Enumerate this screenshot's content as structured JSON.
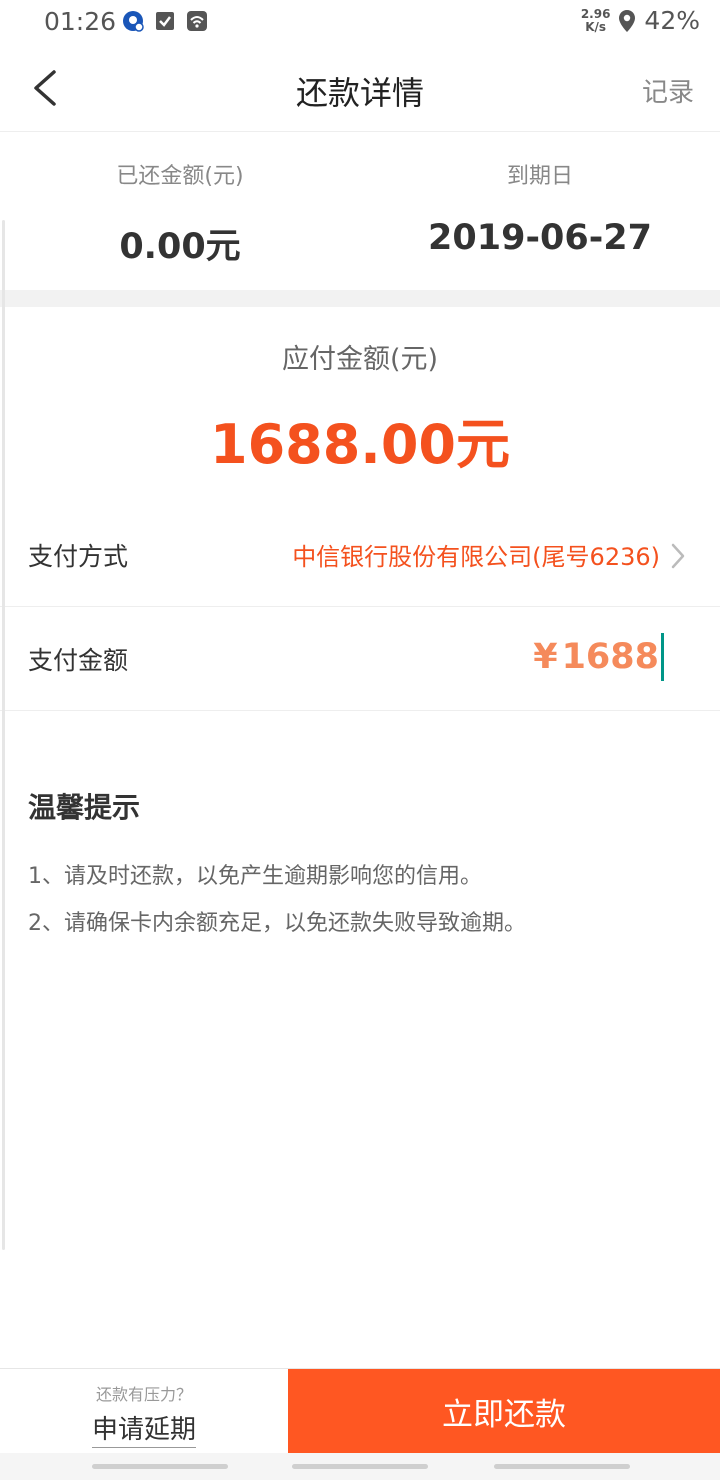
{
  "status_bar": {
    "time": "01:26",
    "net_speed_value": "2.96",
    "net_speed_unit": "K/s",
    "battery": "42%",
    "icons": [
      "notification-badge-icon",
      "checkbox-icon",
      "wifi-icon",
      "location-icon"
    ]
  },
  "nav": {
    "title": "还款详情",
    "record_label": "记录",
    "back_icon": "chevron-left-icon"
  },
  "summary": {
    "paid_label": "已还金额(元)",
    "paid_value": "0.00元",
    "due_date_label": "到期日",
    "due_date_value": "2019-06-27"
  },
  "due": {
    "label": "应付金额(元)",
    "value": "1688.00元"
  },
  "payment": {
    "method_label": "支付方式",
    "method_value": "中信银行股份有限公司(尾号6236)",
    "amount_label": "支付金额",
    "amount_currency": "¥",
    "amount_value": "1688"
  },
  "tips": {
    "title": "温馨提示",
    "lines": [
      "1、请及时还款，以免产生逾期影响您的信用。",
      "2、请确保卡内余额充足，以免还款失败导致逾期。"
    ]
  },
  "bottom": {
    "extend_hint": "还款有压力？",
    "extend_label": "申请延期",
    "pay_label": "立即还款"
  },
  "colors": {
    "accent": "#f4511e",
    "pay_button": "#ff5722",
    "caret": "#009688"
  }
}
